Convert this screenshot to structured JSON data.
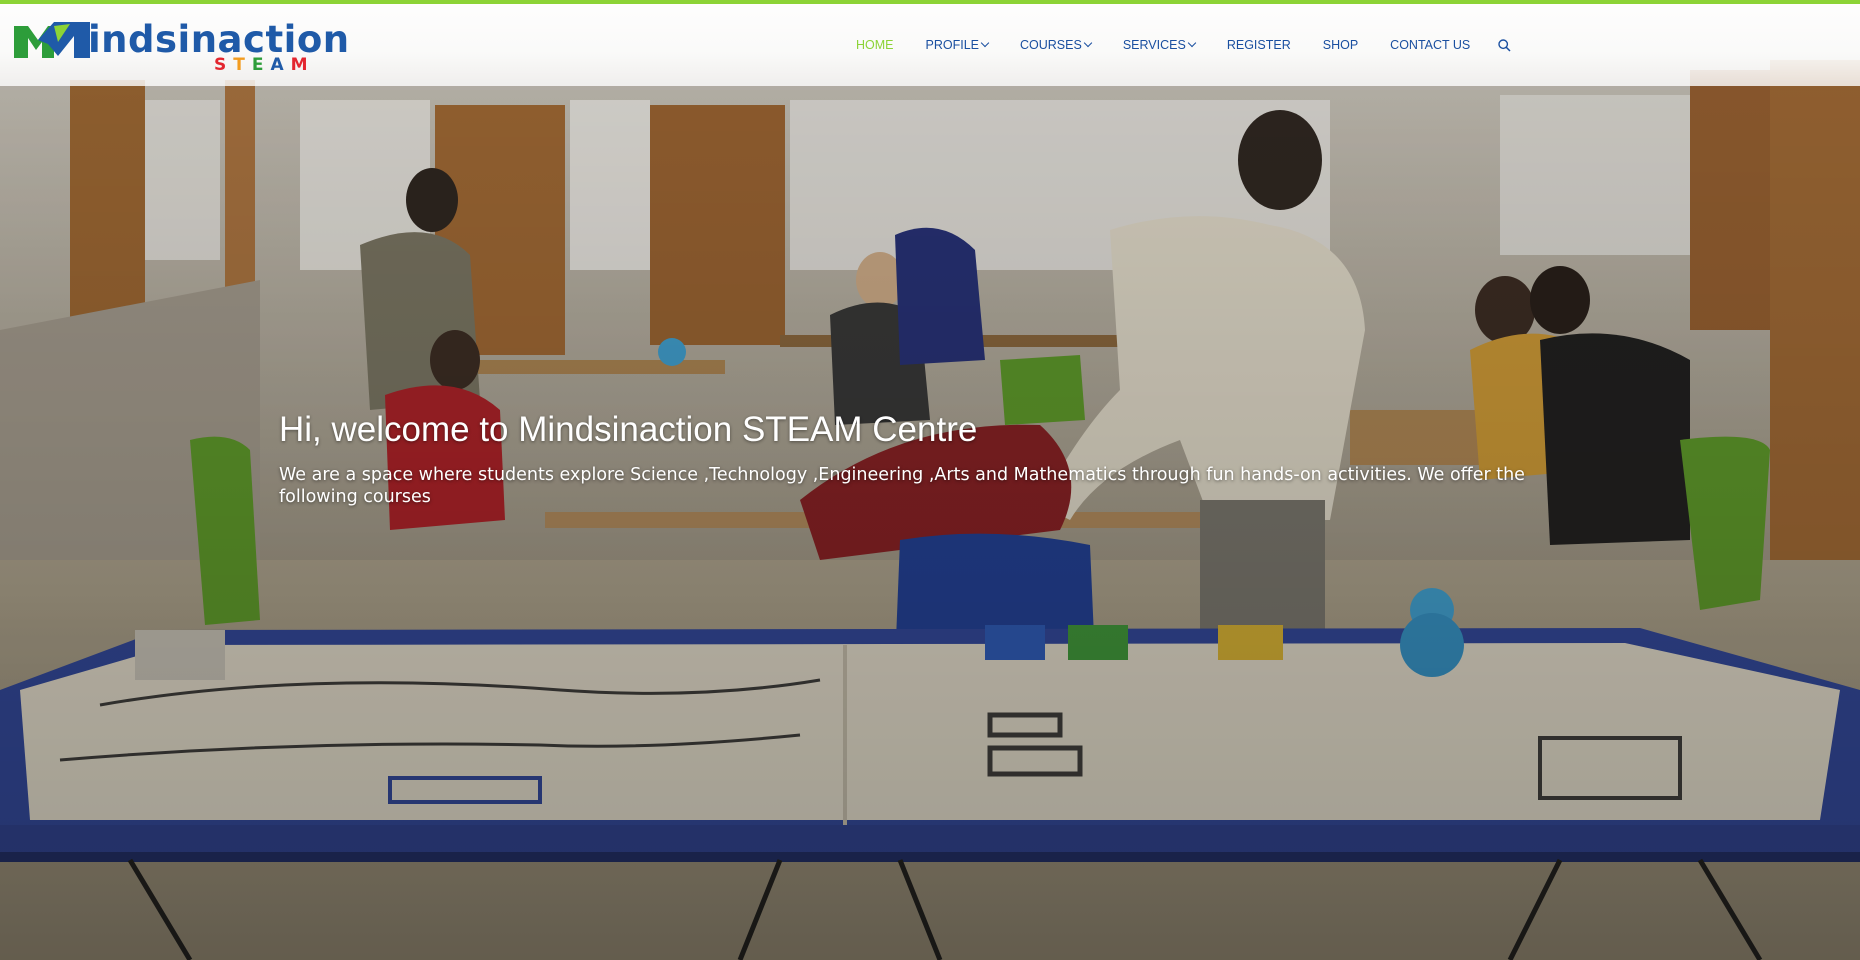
{
  "header": {
    "logo": {
      "word": "Mindsinaction",
      "word_rest": "indsinaction",
      "steam_letters": [
        {
          "char": "S",
          "color": "#e3262f"
        },
        {
          "char": "T",
          "color": "#f39c1f"
        },
        {
          "char": "E",
          "color": "#2d9d3a"
        },
        {
          "char": "A",
          "color": "#1f5aa8"
        },
        {
          "char": "M",
          "color": "#e3262f"
        }
      ]
    },
    "nav": [
      {
        "label": "HOME",
        "active": true,
        "has_dropdown": false
      },
      {
        "label": "PROFILE",
        "active": false,
        "has_dropdown": true
      },
      {
        "label": "COURSES",
        "active": false,
        "has_dropdown": true
      },
      {
        "label": "SERVICES",
        "active": false,
        "has_dropdown": true
      },
      {
        "label": "REGISTER",
        "active": false,
        "has_dropdown": false
      },
      {
        "label": "SHOP",
        "active": false,
        "has_dropdown": false
      },
      {
        "label": "CONTACT US",
        "active": false,
        "has_dropdown": false
      }
    ],
    "search_icon": "search-icon"
  },
  "hero": {
    "title": "Hi, welcome to Mindsinaction STEAM Centre",
    "subtitle": "We are a space where students explore Science ,Technology ,Engineering ,Arts and Mathematics through fun hands-on activities. We offer the following courses"
  },
  "colors": {
    "accent_green": "#8cd336",
    "nav_blue": "#1a4fa0",
    "logo_blue": "#1f5aa8"
  }
}
